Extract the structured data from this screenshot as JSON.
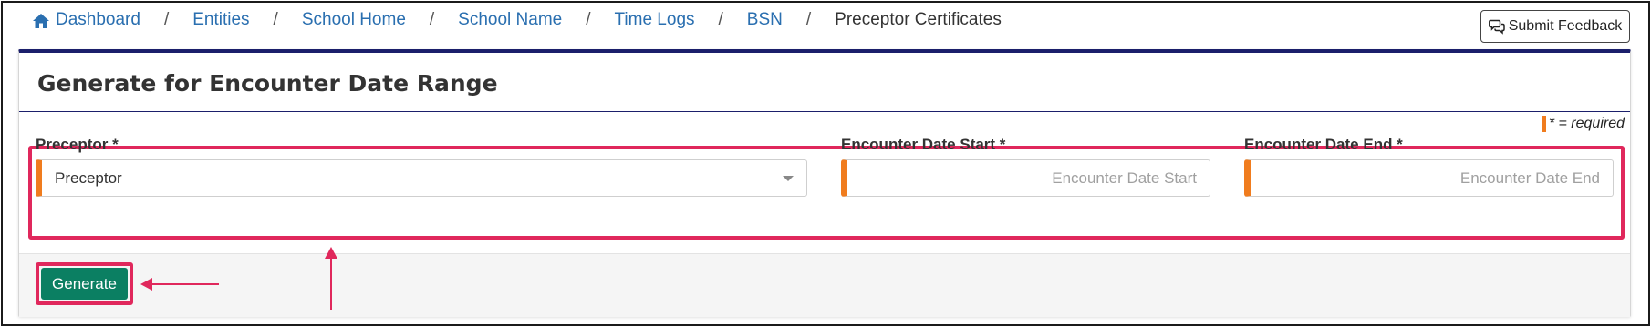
{
  "breadcrumb": {
    "items": [
      "Dashboard",
      "Entities",
      "School Home",
      "School Name",
      "Time Logs",
      "BSN"
    ],
    "current": "Preceptor Certificates",
    "separator": "/"
  },
  "feedback": {
    "label": "Submit Feedback"
  },
  "card": {
    "title": "Generate for Encounter Date Range",
    "required_note": "* = required"
  },
  "form": {
    "preceptor": {
      "label": "Preceptor *",
      "value": "Preceptor"
    },
    "date_start": {
      "label": "Encounter Date Start *",
      "placeholder": "Encounter Date Start",
      "value": ""
    },
    "date_end": {
      "label": "Encounter Date End *",
      "placeholder": "Encounter Date End",
      "value": ""
    }
  },
  "actions": {
    "generate_label": "Generate"
  },
  "colors": {
    "link": "#2a6fb0",
    "accent_navy": "#1b1f6b",
    "required_orange": "#f07c1e",
    "highlight_pink": "#e0285c",
    "generate_green": "#0b7f62"
  },
  "icons": [
    "home-icon",
    "feedback-icon",
    "chevron-down-icon",
    "arrow-up-annotation",
    "arrow-left-annotation"
  ]
}
